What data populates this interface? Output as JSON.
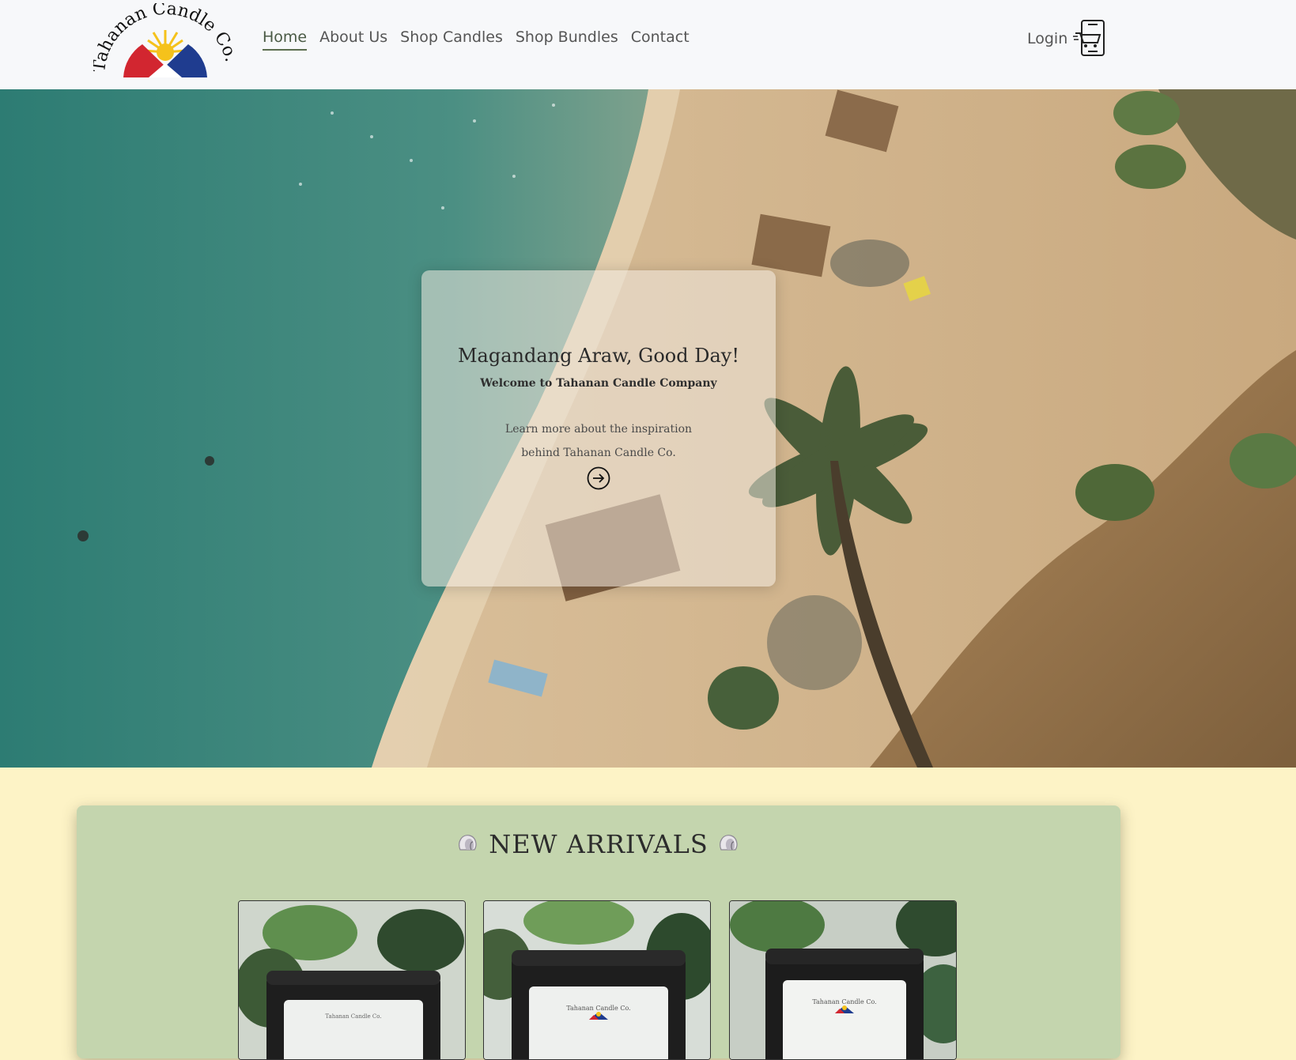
{
  "header": {
    "logo_text": "Tahanan Candle Co.",
    "nav": [
      {
        "label": "Home",
        "active": true
      },
      {
        "label": "About Us",
        "active": false
      },
      {
        "label": "Shop Candles",
        "active": false
      },
      {
        "label": "Shop Bundles",
        "active": false
      },
      {
        "label": "Contact",
        "active": false
      }
    ],
    "login_label": "Login",
    "cart_icon": "shopping-cart-phone-icon"
  },
  "hero": {
    "title": "Magandang Araw, Good Day!",
    "subtitle": "Welcome to Tahanan Candle Company",
    "text": "Learn more about the inspiration behind Tahanan Candle Co.",
    "arrow_icon": "arrow-right-circle-icon"
  },
  "arrivals": {
    "heading": "NEW ARRIVALS",
    "heading_icon": "seashell-icon",
    "products": [
      {
        "label_text": "Tahanan Candle Co."
      },
      {
        "label_text": "Tahanan Candle Co."
      },
      {
        "label_text": "Tahanan Candle Co."
      }
    ]
  },
  "colors": {
    "header_bg": "#f7f8fa",
    "page_bg": "#fdf3c6",
    "arrivals_bg": "#c4d5ae",
    "flag_red": "#d22630",
    "flag_blue": "#1f3c8f",
    "sun_yellow": "#f5c21b"
  }
}
